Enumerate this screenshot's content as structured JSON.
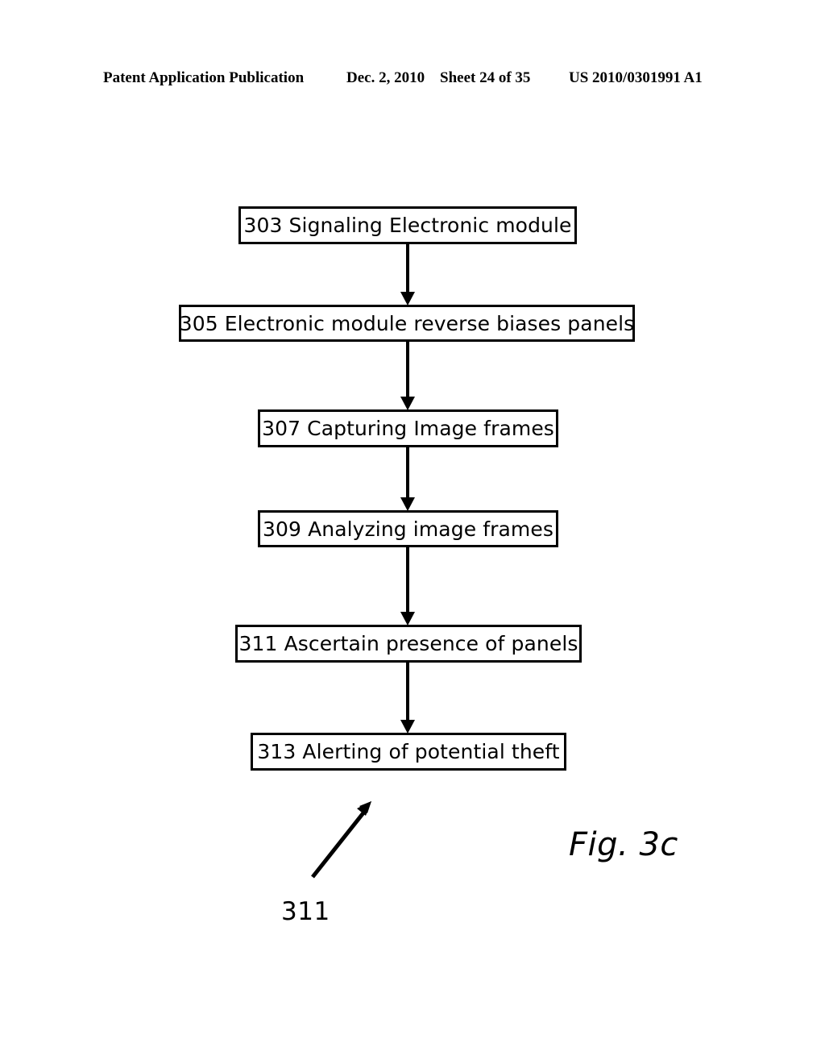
{
  "header": {
    "publication": "Patent Application Publication",
    "date": "Dec. 2, 2010",
    "sheet": "Sheet 24 of 35",
    "patent_number": "US 2010/0301991 A1"
  },
  "figure": {
    "caption": "Fig. 3c",
    "leader_label": "311"
  },
  "chart_data": {
    "type": "diagram",
    "diagram_type": "flowchart",
    "title": "Fig. 3c",
    "orientation": "top-to-bottom",
    "nodes": [
      {
        "id": "303",
        "label": "303 Signaling Electronic module"
      },
      {
        "id": "305",
        "label": "305 Electronic module reverse biases panels"
      },
      {
        "id": "307",
        "label": "307 Capturing Image frames"
      },
      {
        "id": "309",
        "label": "309 Analyzing image frames"
      },
      {
        "id": "311",
        "label": "311 Ascertain presence of panels"
      },
      {
        "id": "313",
        "label": "313 Alerting of potential theft"
      }
    ],
    "edges": [
      {
        "from": "303",
        "to": "305",
        "style": "arrow"
      },
      {
        "from": "305",
        "to": "307",
        "style": "arrow"
      },
      {
        "from": "307",
        "to": "309",
        "style": "arrow"
      },
      {
        "from": "309",
        "to": "311",
        "style": "arrow"
      },
      {
        "from": "311",
        "to": "313",
        "style": "arrow"
      }
    ],
    "annotations": [
      {
        "text": "311",
        "type": "reference-numeral",
        "pointer": "diagonal-arrow-up-right"
      },
      {
        "text": "Fig. 3c",
        "type": "figure-caption"
      }
    ],
    "colors": {
      "stroke": "#000000",
      "fill": "#ffffff",
      "text": "#000000"
    }
  }
}
